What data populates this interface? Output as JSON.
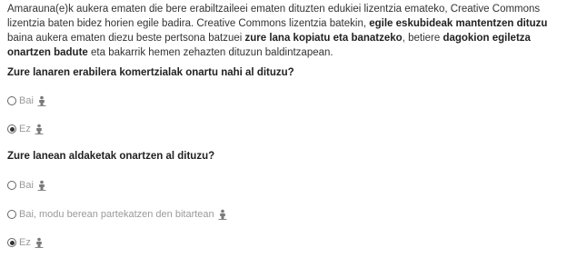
{
  "intro": {
    "p1": "Amarauna(e)k aukera ematen die bere erabiltzaileei ematen dituzten edukiei lizentzia emateko, Creative Commons lizentzia baten bidez horien egile badira. Creative Commons lizentzia batekin, ",
    "b1": "egile eskubideak mantentzen dituzu",
    "p2": " baina aukera ematen diezu beste pertsona batzuei ",
    "b2": "zure lana kopiatu eta banatzeko",
    "p3": ", betiere ",
    "b3": "dagokion egiletza onartzen badute",
    "p4": " eta bakarrik hemen zehazten dituzun baldintzapean."
  },
  "q1": {
    "title": "Zure lanaren erabilera komertzialak onartu nahi al dituzu?",
    "options": [
      {
        "label": "Bai",
        "checked": false,
        "icon": "attribution-icon"
      },
      {
        "label": "Ez",
        "checked": true,
        "icon": "attribution-icon"
      }
    ]
  },
  "q2": {
    "title": "Zure lanean aldaketak onartzen al dituzu?",
    "options": [
      {
        "label": "Bai",
        "checked": false,
        "icon": "attribution-icon"
      },
      {
        "label": "Bai, modu berean partekatzen den bitartean",
        "checked": false,
        "icon": "attribution-icon"
      },
      {
        "label": "Ez",
        "checked": true,
        "icon": "attribution-icon"
      }
    ]
  }
}
